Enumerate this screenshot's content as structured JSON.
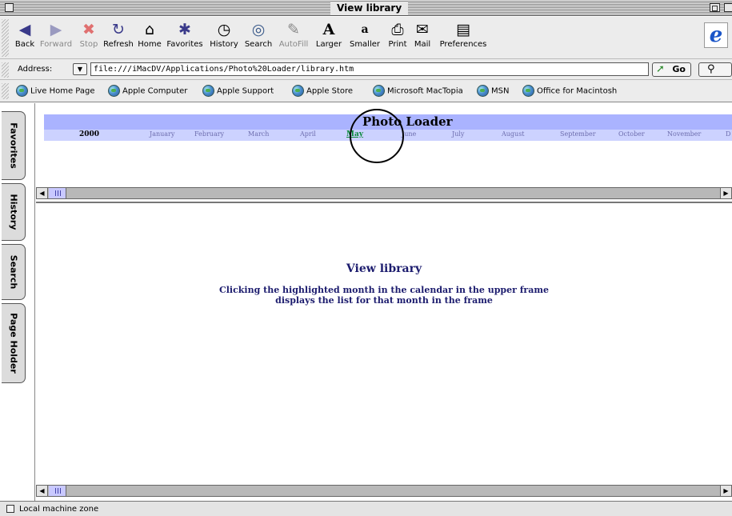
{
  "window": {
    "title": "View library"
  },
  "toolbar": {
    "buttons": [
      {
        "label": "Back",
        "icon": "back-arrow-icon",
        "glyph": "◀"
      },
      {
        "label": "Forward",
        "icon": "forward-arrow-icon",
        "glyph": "▶"
      },
      {
        "label": "Stop",
        "icon": "stop-icon",
        "glyph": "✖"
      },
      {
        "label": "Refresh",
        "icon": "refresh-icon",
        "glyph": "↻"
      },
      {
        "label": "Home",
        "icon": "home-icon",
        "glyph": "⌂"
      },
      {
        "label": "Favorites",
        "icon": "favorites-icon",
        "glyph": "✱"
      },
      {
        "label": "History",
        "icon": "history-icon",
        "glyph": "◷"
      },
      {
        "label": "Search",
        "icon": "search-icon",
        "glyph": "◎"
      },
      {
        "label": "AutoFill",
        "icon": "autofill-icon",
        "glyph": "✎"
      },
      {
        "label": "Larger",
        "icon": "larger-text-icon",
        "glyph": "A"
      },
      {
        "label": "Smaller",
        "icon": "smaller-text-icon",
        "glyph": "a"
      },
      {
        "label": "Print",
        "icon": "print-icon",
        "glyph": "⎙"
      },
      {
        "label": "Mail",
        "icon": "mail-icon",
        "glyph": "✉"
      },
      {
        "label": "Preferences",
        "icon": "preferences-icon",
        "glyph": "▤"
      }
    ]
  },
  "address": {
    "label": "Address:",
    "url": "file:///iMacDV/Applications/Photo%20Loader/library.htm",
    "go_label": "Go"
  },
  "favorites_bar": [
    "Live Home Page",
    "Apple Computer",
    "Apple Support",
    "Apple Store",
    "Microsoft MacTopia",
    "MSN",
    "Office for Macintosh"
  ],
  "sidebar_tabs": [
    "Favorites",
    "History",
    "Search",
    "Page Holder"
  ],
  "top_frame": {
    "title": "Photo Loader",
    "year": "2000",
    "months": [
      "January",
      "February",
      "March",
      "April",
      "May",
      "June",
      "July",
      "August",
      "September",
      "October",
      "November",
      "D"
    ],
    "highlighted_month": "May"
  },
  "bottom_frame": {
    "heading": "View library",
    "description_line1": "Clicking the highlighted month in the calendar in the upper frame",
    "description_line2": "displays the list for that month in the frame"
  },
  "status": {
    "zone": "Local machine zone"
  }
}
